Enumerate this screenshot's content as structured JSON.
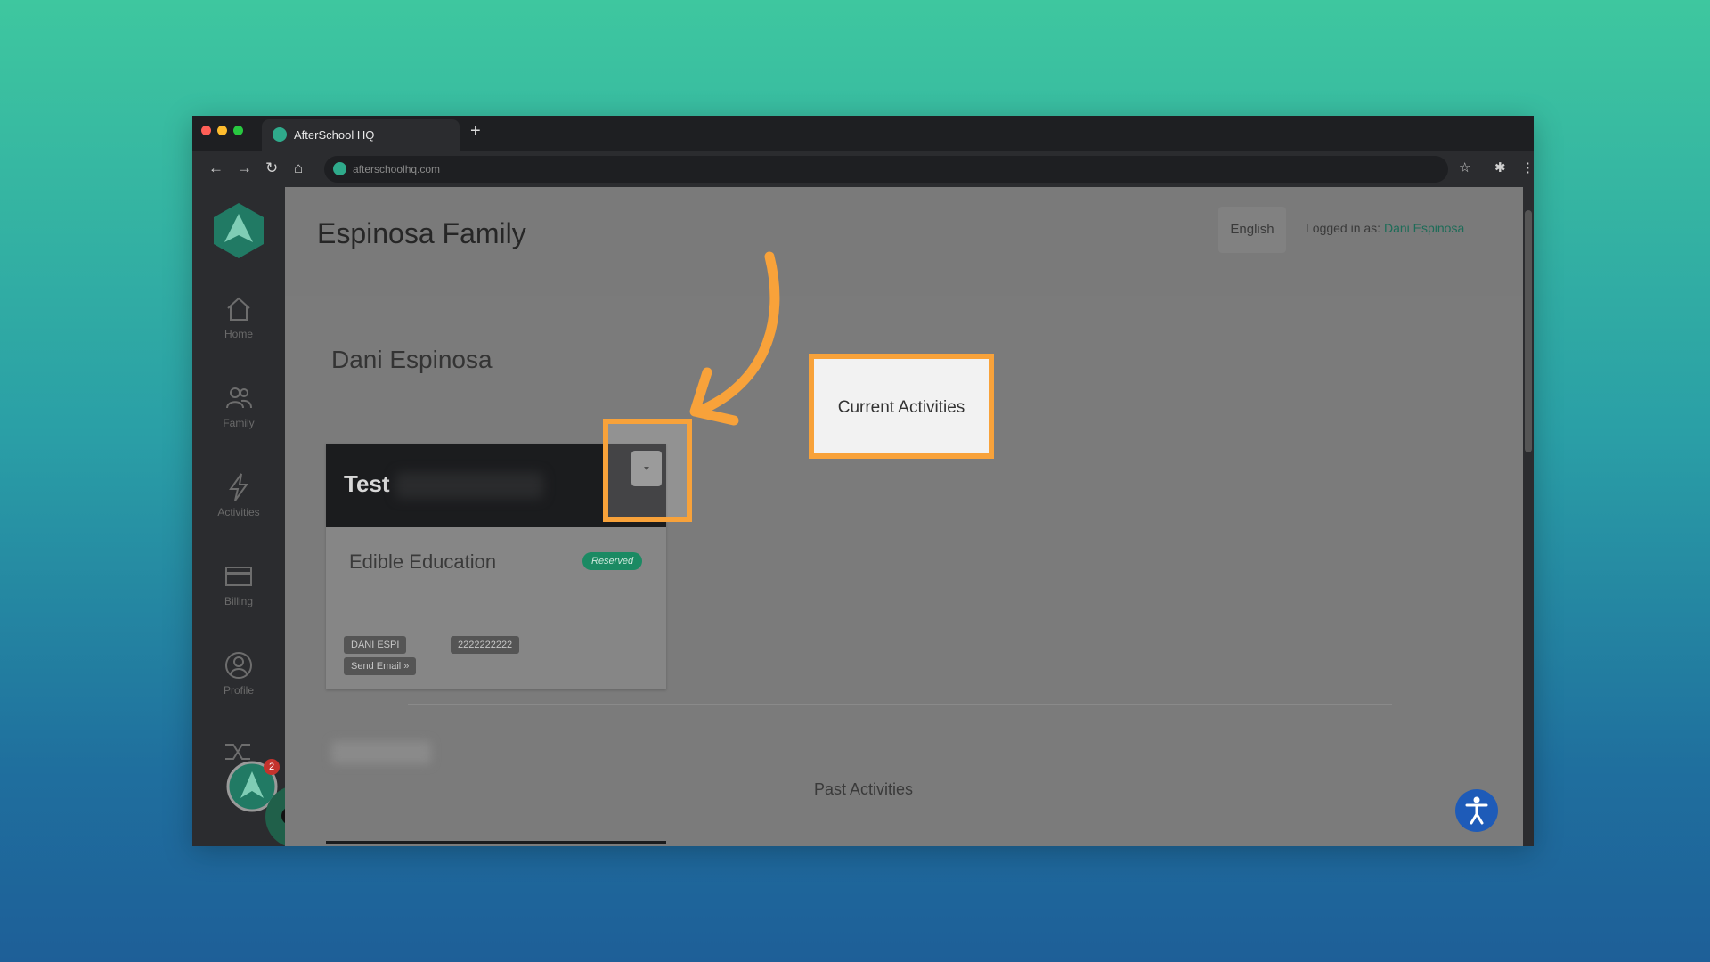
{
  "browser": {
    "tab_title": "AfterSchool HQ",
    "url": "afterschoolhq.com",
    "new_tab_icon": "plus-icon",
    "dots": [
      "#ff5f57",
      "#febc2e",
      "#28c840"
    ]
  },
  "header": {
    "title": "Espinosa Family",
    "language": "English",
    "logged_in_prefix": "Logged in as:",
    "user_name": "Dani Espinosa"
  },
  "sidebar": {
    "items": [
      {
        "label": "Home",
        "icon": "home-icon"
      },
      {
        "label": "Family",
        "icon": "family-icon"
      },
      {
        "label": "Activities",
        "icon": "lightning-icon"
      },
      {
        "label": "Billing",
        "icon": "billing-icon"
      },
      {
        "label": "Profile",
        "icon": "profile-icon"
      }
    ],
    "notification_count": "2"
  },
  "main": {
    "member_name": "Dani Espinosa",
    "card": {
      "title": "Test",
      "activity": "Edible Education",
      "status": "Reserved",
      "chips": [
        "DANI ESPI",
        "2222222222",
        "Send Email »"
      ]
    },
    "past_label": "Past Activities"
  },
  "annotation": {
    "callout_text": "Current Activities",
    "accent": "#f8a23a"
  }
}
